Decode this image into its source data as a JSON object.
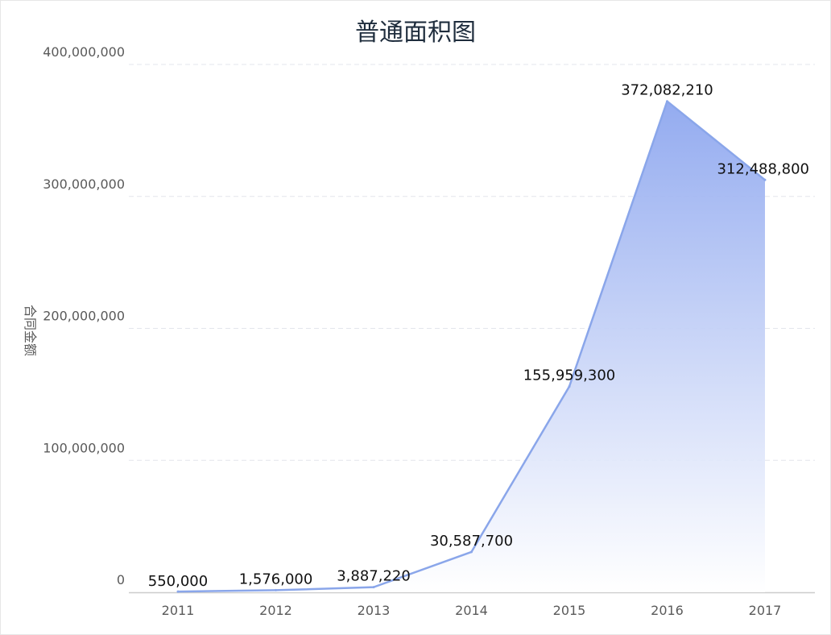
{
  "chart_data": {
    "type": "area",
    "title": "普通面积图",
    "xlabel": "",
    "ylabel": "合同金额",
    "categories": [
      "2011",
      "2012",
      "2013",
      "2014",
      "2015",
      "2016",
      "2017"
    ],
    "series": [
      {
        "values": [
          550000,
          1576000,
          3887220,
          30587700,
          155959300,
          372082210,
          312488800
        ]
      }
    ],
    "data_labels": [
      "550,000",
      "1,576,000",
      "3,887,220",
      "30,587,700",
      "155,959,300",
      "372,082,210",
      "312,488,800"
    ],
    "y_ticks": [
      0,
      100000000,
      200000000,
      300000000,
      400000000
    ],
    "y_tick_labels": [
      "0",
      "100,000,000",
      "200,000,000",
      "300,000,000",
      "400,000,000"
    ],
    "ylim": [
      0,
      400000000
    ],
    "grid": true,
    "legend": "none",
    "colors": {
      "line": "#8aa6ea",
      "fill_top": "#8ea7ef",
      "fill_bottom": "#ffffff",
      "grid": "#e3e6ec",
      "axis": "#cccccc",
      "text": "#5a5a5a",
      "title": "#1f2d3d"
    }
  }
}
